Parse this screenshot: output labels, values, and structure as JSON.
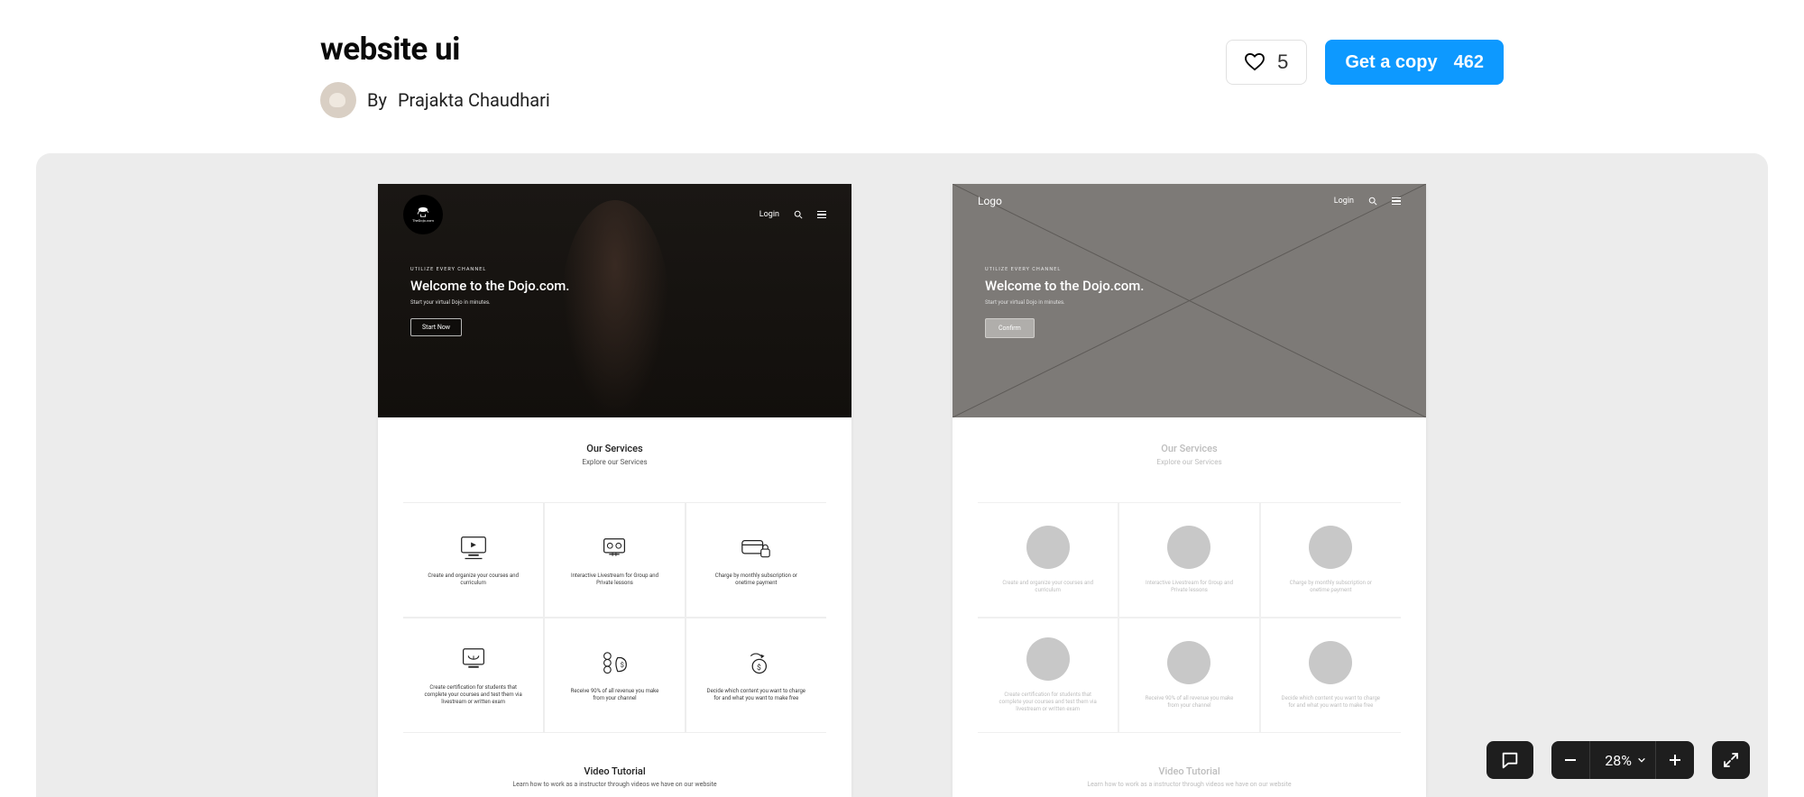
{
  "header": {
    "title": "website ui",
    "author_prefix": "By",
    "author_name": "Prajakta Chaudhari",
    "like_count": "5",
    "get_copy_label": "Get a copy",
    "copy_count": "462"
  },
  "toolbar": {
    "zoom_value": "28%"
  },
  "mockups": {
    "services_title": "Our Services",
    "services_sub": "Explore our Services",
    "tutorial_title": "Video Tutorial",
    "tutorial_sub": "Learn how to work as a instructor through videos we have on our website",
    "hero": {
      "eyebrow": "UTILIZE EVERY CHANNEL",
      "title": "Welcome to the Dojo.com.",
      "sub": "Start your virtual Dojo in minutes.",
      "start_label": "Start Now",
      "confirm_label": "Confirm",
      "login_label": "Login",
      "logo_text": "TheDojo.com",
      "wire_logo": "Logo"
    },
    "cells": [
      "Create and organize your courses and curriculum",
      "Interactive Livestream for Group and Private lessons",
      "Charge by monthly subscription or onetime payment",
      "Create certification for students that complete your courses and test them via livestream or written exam",
      "Receive 90% of all revenue you make from your channel",
      "Decide which content you want to charge for and what you want to make free"
    ]
  }
}
